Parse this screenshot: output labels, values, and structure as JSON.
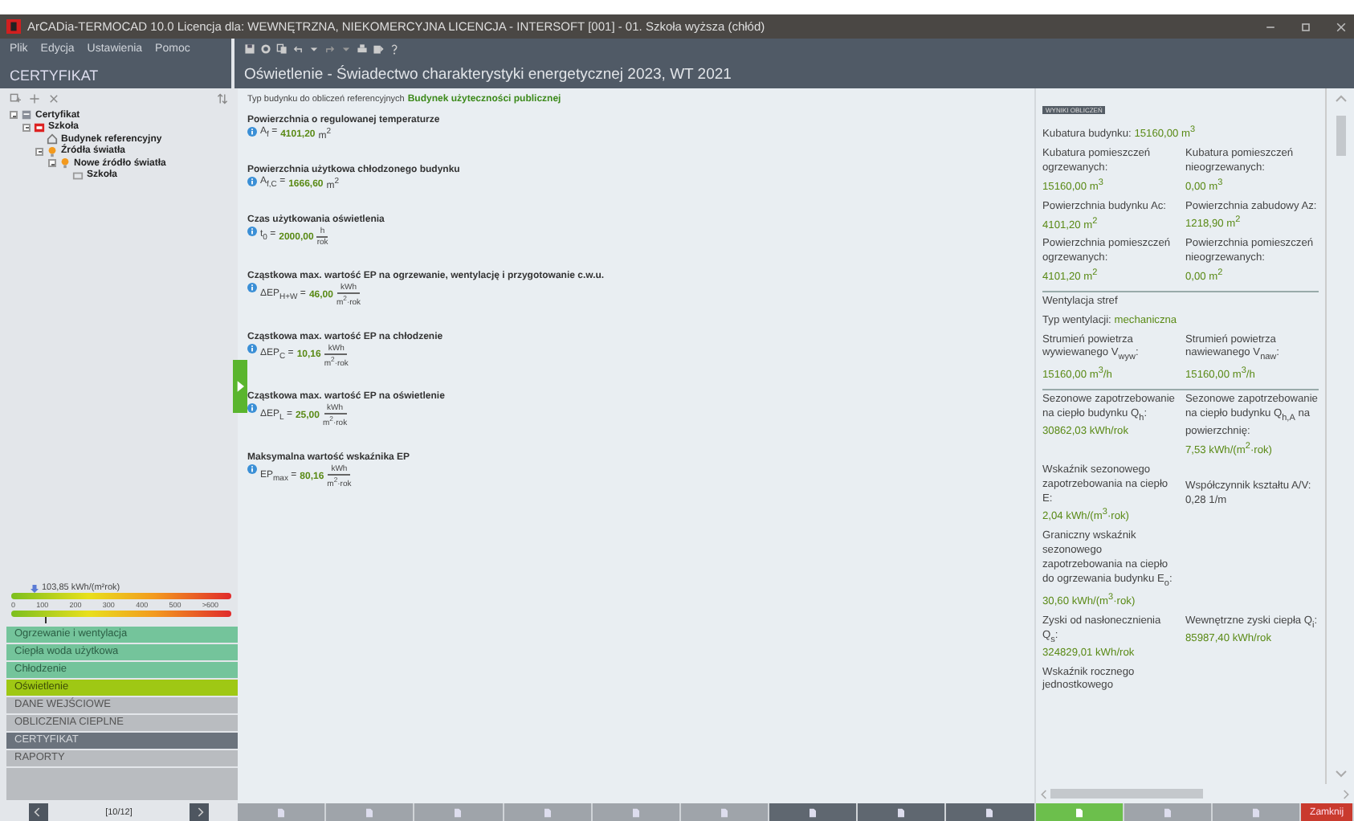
{
  "window": {
    "title": "ArCADia-TERMOCAD 10.0 Licencja dla: WEWNĘTRZNA, NIEKOMERCYJNA LICENCJA - INTERSOFT [001] - 01. Szkoła wyższa (chłód)"
  },
  "menu": [
    "Plik",
    "Edycja",
    "Ustawienia",
    "Pomoc"
  ],
  "sidebar": {
    "title": "CERTYFIKAT",
    "tree": [
      {
        "label": "Certyfikat",
        "kind": "cert",
        "expanded": true,
        "children": [
          {
            "label": "Szkoła",
            "kind": "building",
            "expanded": true,
            "children": [
              {
                "label": "Budynek referencyjny",
                "kind": "house"
              },
              {
                "label": "Źródła światła",
                "kind": "bulb",
                "expanded": true,
                "children": [
                  {
                    "label": "Nowe źródło światła",
                    "kind": "bulb",
                    "expanded": true,
                    "children": [
                      {
                        "label": "Szkoła",
                        "kind": "room"
                      }
                    ]
                  }
                ]
              }
            ]
          }
        ]
      }
    ],
    "scale": {
      "reading": "103,85 kWh/(m²rok)",
      "level": 0.15,
      "ticks": [
        "0",
        "100",
        "200",
        "300",
        "400",
        "500",
        ">600"
      ]
    },
    "nav": [
      {
        "label": "Ogrzewanie i wentylacja",
        "kind": "category",
        "selected": false
      },
      {
        "label": "Ciepła woda użytkowa",
        "kind": "category",
        "selected": false
      },
      {
        "label": "Chłodzenie",
        "kind": "category",
        "selected": false
      },
      {
        "label": "Oświetlenie",
        "kind": "category",
        "selected": true
      },
      {
        "label": "DANE WEJŚCIOWE",
        "kind": "section",
        "selected": false
      },
      {
        "label": "OBLICZENIA CIEPLNE",
        "kind": "section",
        "selected": false
      },
      {
        "label": "CERTYFIKAT",
        "kind": "section",
        "selected": true
      },
      {
        "label": "RAPORTY",
        "kind": "section",
        "selected": false
      }
    ],
    "pager": "[10/12]"
  },
  "main": {
    "title": "Oświetlenie - Świadectwo charakterystyki energetycznej 2023, WT 2021",
    "building_type_label": "Typ budynku do obliczeń referencyjnych",
    "building_type": "Budynek użyteczności publicznej",
    "fields": [
      {
        "label": "Powierzchnia o regulowanej temperaturze",
        "symbol": "A$_{f}$ =",
        "value": "4101,20",
        "unit": "m$^{2}$",
        "kind": "plain"
      },
      {
        "label": "Powierzchnia użytkowa chłodzonego budynku",
        "symbol": "A$_{f,C}$ =",
        "value": "1666,60",
        "unit": "m$^{2}$",
        "kind": "plain"
      },
      {
        "label": "Czas użytkowania oświetlenia",
        "symbol": "t$_{0}$ =",
        "value": "2000,00",
        "num": "h",
        "den": "rok",
        "kind": "fraction"
      },
      {
        "label": "Cząstkowa max. wartość EP na ogrzewanie, wentylację i przygotowanie c.w.u.",
        "symbol": "ΔEP$_{H+W}$ =",
        "value": "46,00",
        "num": "kWh",
        "den": "m$^{2}$·rok",
        "kind": "fraction"
      },
      {
        "label": "Cząstkowa max. wartość EP na chłodzenie",
        "symbol": "ΔEP$_{C}$ =",
        "value": "10,16",
        "num": "kWh",
        "den": "m$^{2}$·rok",
        "kind": "fraction"
      },
      {
        "label": "Cząstkowa max. wartość EP na oświetlenie",
        "symbol": "ΔEP$_{L}$ =",
        "value": "25,00",
        "num": "kWh",
        "den": "m$^{2}$·rok",
        "kind": "fraction"
      },
      {
        "label": "Maksymalna wartość wskaźnika EP",
        "symbol": "EP$_{max}$ =",
        "value": "80,16",
        "num": "kWh",
        "den": "m$^{2}$·rok",
        "kind": "fraction"
      }
    ]
  },
  "results": {
    "badge": "WYNIKI OBLICZEŃ",
    "sections": [
      [
        {
          "label": "Kubatura budynku:",
          "value": "15160,00 m$^{3}$",
          "kind": "inline"
        },
        {
          "label": "Kubatura pomieszczeń ogrzewanych:",
          "value": "15160,00 m$^{3}$",
          "kind": "stacked"
        },
        {
          "label": "Kubatura pomieszczeń nieogrzewanych:",
          "value": "0,00 m$^{3}$",
          "kind": "stacked"
        },
        {
          "label": "Powierzchnia budynku Ac:",
          "value": "4101,20 m$^{2}$",
          "kind": "half-inline"
        },
        {
          "label": "Powierzchnia zabudowy Az:",
          "value": "1218,90 m$^{2}$",
          "kind": "stacked"
        },
        {
          "label": "Powierzchnia pomieszczeń ogrzewanych:",
          "value": "4101,20 m$^{2}$",
          "kind": "stacked"
        },
        {
          "label": "Powierzchnia pomieszczeń nieogrzewanych:",
          "value": "0,00 m$^{2}$",
          "kind": "stacked"
        }
      ],
      [
        {
          "label": "Wentylacja stref",
          "kind": "heading"
        },
        {
          "label": "Typ wentylacji:",
          "value": "mechaniczna",
          "kind": "inline"
        },
        {
          "label": "Strumień powietrza wywiewanego V$_{wyw}$:",
          "value": "15160,00 m$^{3}$/h",
          "kind": "stacked"
        },
        {
          "label": "Strumień powietrza nawiewanego V$_{naw}$:",
          "value": "15160,00 m$^{3}$/h",
          "kind": "stacked"
        }
      ],
      [
        {
          "label": "Sezonowe zapotrzebowanie na ciepło budynku Q$_{h}$:",
          "value": "30862,03 kWh/rok",
          "kind": "stacked"
        },
        {
          "label": "Sezonowe zapotrzebowanie na ciepło budynku Q$_{h,A}$ na powierzchnię:",
          "value": "7,53 kWh/(m$^{2}$·rok)",
          "kind": "stacked"
        },
        {
          "label": "Wskaźnik sezonowego zapotrzebowania na ciepło E:",
          "value": "2,04 kWh/(m$^{3}$·rok)",
          "kind": "stacked"
        },
        {
          "label": "Współczynnik kształtu A/V: 0,28 1/m",
          "kind": "note"
        },
        {
          "label": "Graniczny wskaźnik sezonowego zapotrzebowania na ciepło do ogrzewania budynku E$_{o}$:",
          "value": "30,60 kWh/(m$^{3}$·rok)",
          "kind": "stacked"
        },
        {
          "kind": "empty"
        },
        {
          "label": "Zyski od nasłonecznienia Q$_{s}$:",
          "value": "324829,01 kWh/rok",
          "kind": "stacked"
        },
        {
          "label": "Wewnętrzne zyski ciepła Q$_{i}$:",
          "value": "85987,40 kWh/rok",
          "kind": "stacked"
        },
        {
          "label": "Wskaźnik rocznego jednostkowego",
          "kind": "note"
        }
      ]
    ]
  },
  "bottom_bar": [
    {
      "selected": false,
      "kind": "tool"
    },
    {
      "selected": false,
      "kind": "tool"
    },
    {
      "selected": false,
      "kind": "tool"
    },
    {
      "selected": false,
      "kind": "tool"
    },
    {
      "selected": false,
      "kind": "tool"
    },
    {
      "selected": false,
      "kind": "tool"
    },
    {
      "selected": false,
      "kind": "dark"
    },
    {
      "selected": false,
      "kind": "dark"
    },
    {
      "selected": false,
      "kind": "dark"
    },
    {
      "selected": true,
      "kind": "tool"
    },
    {
      "selected": false,
      "kind": "tool"
    },
    {
      "selected": false,
      "kind": "tool"
    },
    {
      "kind": "close",
      "label": "Zamknij"
    }
  ]
}
